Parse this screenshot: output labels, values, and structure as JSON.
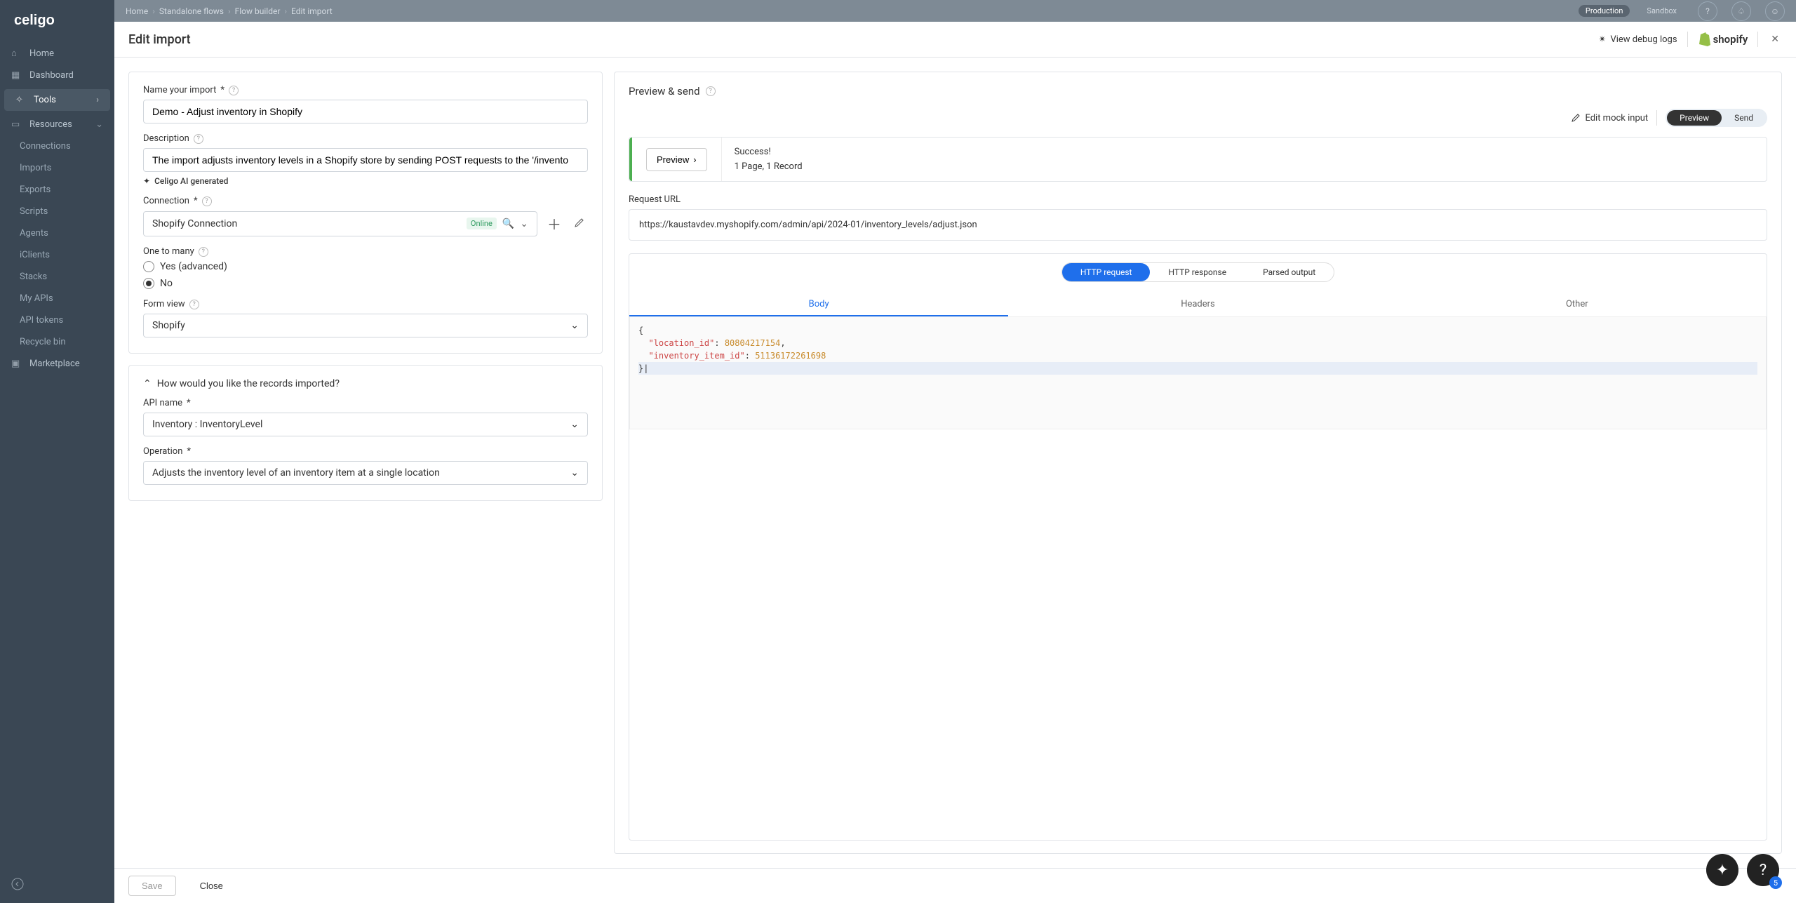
{
  "app": {
    "logo_text": "celigo",
    "page_title": "Edit import"
  },
  "breadcrumb": [
    "Home",
    "Standalone flows",
    "Flow builder",
    "Edit import"
  ],
  "env": {
    "production": "Production",
    "sandbox": "Sandbox"
  },
  "sidebar": {
    "home": "Home",
    "dashboard": "Dashboard",
    "tools": "Tools",
    "resources": "Resources",
    "items": [
      "Connections",
      "Imports",
      "Exports",
      "Scripts",
      "Agents",
      "iClients",
      "Stacks",
      "My APIs",
      "API tokens",
      "Recycle bin"
    ],
    "marketplace": "Marketplace"
  },
  "header": {
    "debug": "View debug logs",
    "shopify": "shopify"
  },
  "form": {
    "name_label": "Name your import",
    "name_value": "Demo - Adjust inventory in Shopify",
    "desc_label": "Description",
    "desc_value": "The import adjusts inventory levels in a Shopify store by sending POST requests to the '/invento",
    "ai_gen": "Celigo AI generated",
    "conn_label": "Connection",
    "conn_value": "Shopify Connection",
    "conn_status": "Online",
    "otm_label": "One to many",
    "otm_yes": "Yes (advanced)",
    "otm_no": "No",
    "view_label": "Form view",
    "view_value": "Shopify",
    "section2": "How would you like the records imported?",
    "api_label": "API name",
    "api_value": "Inventory : InventoryLevel",
    "op_label": "Operation",
    "op_value": "Adjusts the inventory level of an inventory item at a single location"
  },
  "preview": {
    "title": "Preview & send",
    "mock": "Edit mock input",
    "toggle_preview": "Preview",
    "toggle_send": "Send",
    "preview_btn": "Preview",
    "success": "Success!",
    "pages": "1 Page, 1 Record",
    "url_label": "Request URL",
    "url": "https://kaustavdev.myshopify.com/admin/api/2024-01/inventory_levels/adjust.json",
    "tabs": [
      "HTTP request",
      "HTTP response",
      "Parsed output"
    ],
    "subtabs": [
      "Body",
      "Headers",
      "Other"
    ],
    "body": {
      "location_id": "80804217154",
      "inventory_item_id": "51136172261698"
    }
  },
  "footer": {
    "save": "Save",
    "close": "Close"
  },
  "fab_badge": "5"
}
